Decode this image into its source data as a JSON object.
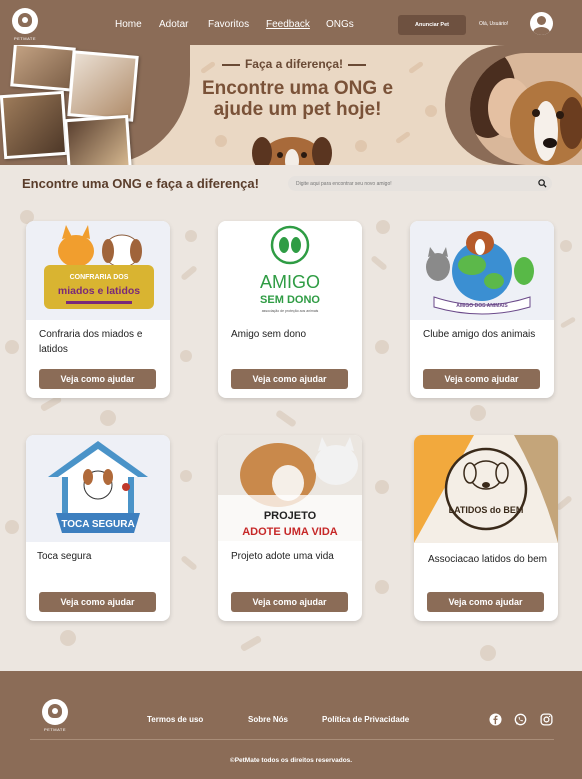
{
  "header": {
    "logo_text": "PETMATE",
    "nav": [
      "Home",
      "Adotar",
      "Favoritos",
      "Feedback",
      "ONGs"
    ],
    "announce_button": "Anunciar Pet",
    "greeting": "Olá, Usuário!",
    "brand_color": "#8b6c57"
  },
  "hero": {
    "subtitle": "Faça a diferença!",
    "title": "Encontre uma ONG e ajude um pet hoje!"
  },
  "main": {
    "section_title": "Encontre uma ONG e faça a diferença!",
    "search_placeholder": "Digite aqui para encontrar seu novo amigo!"
  },
  "cards": [
    {
      "name": "Confraria dos miados e latidos",
      "button": "Veja como ajudar",
      "logo_top": "CONFRARIA DOS",
      "logo_main": "miados e latidos"
    },
    {
      "name": "Amigo sem dono",
      "button": "Veja como ajudar",
      "logo_main": "AMIGO",
      "logo_sub": "SEM DONO",
      "logo_tag": "associação de proteção aos animais"
    },
    {
      "name": "Clube amigo dos animais",
      "button": "Veja como ajudar",
      "logo_ribbon": "AMIGO DOS ANIMAIS"
    },
    {
      "name": "Toca segura",
      "button": "Veja como ajudar",
      "logo_main": "TOCA SEGURA"
    },
    {
      "name": "Projeto adote uma vida",
      "button": "Veja como ajudar",
      "logo_top": "PROJETO",
      "logo_main": "ADOTE UMA VIDA"
    },
    {
      "name": "Associacao latidos do bem",
      "button": "Veja como ajudar",
      "logo_main": "LATIDOS do BEM"
    }
  ],
  "footer": {
    "logo_text": "PETMATE",
    "links": [
      "Termos de uso",
      "Sobre Nós",
      "Política de Privacidade"
    ],
    "social": [
      "facebook-icon",
      "whatsapp-icon",
      "instagram-icon"
    ],
    "copyright": "©PetMate todos os direitos reservados."
  }
}
